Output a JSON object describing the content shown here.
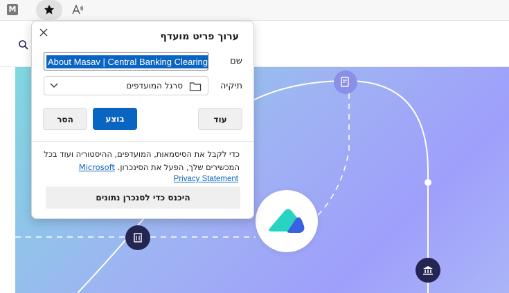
{
  "toolbar": {
    "extension_letter": "M",
    "favorite_icon": "star-icon",
    "read_aloud_icon": "read-aloud-icon"
  },
  "popup": {
    "title": "ערוך פריט מועדף",
    "name_label": "שם",
    "name_value": "About Masav | Central Banking Clearing Center",
    "folder_label": "תיקיה",
    "folder_value": "סרגל המועדפים",
    "more_button": "עוד",
    "done_button": "בוצע",
    "remove_button": "הסר",
    "sync_text": "כדי לקבל את הסיסמאות, המועדפים, ההיסטוריה ועוד בכל המכשירים שלך, הפעל את הסינכרון.",
    "microsoft_link": "Microsoft",
    "privacy_link": "Privacy Statement",
    "signin_button": "היכנס כדי לסנכרן נתונים"
  },
  "colors": {
    "accent": "#0a64c2",
    "node": "#242553"
  }
}
